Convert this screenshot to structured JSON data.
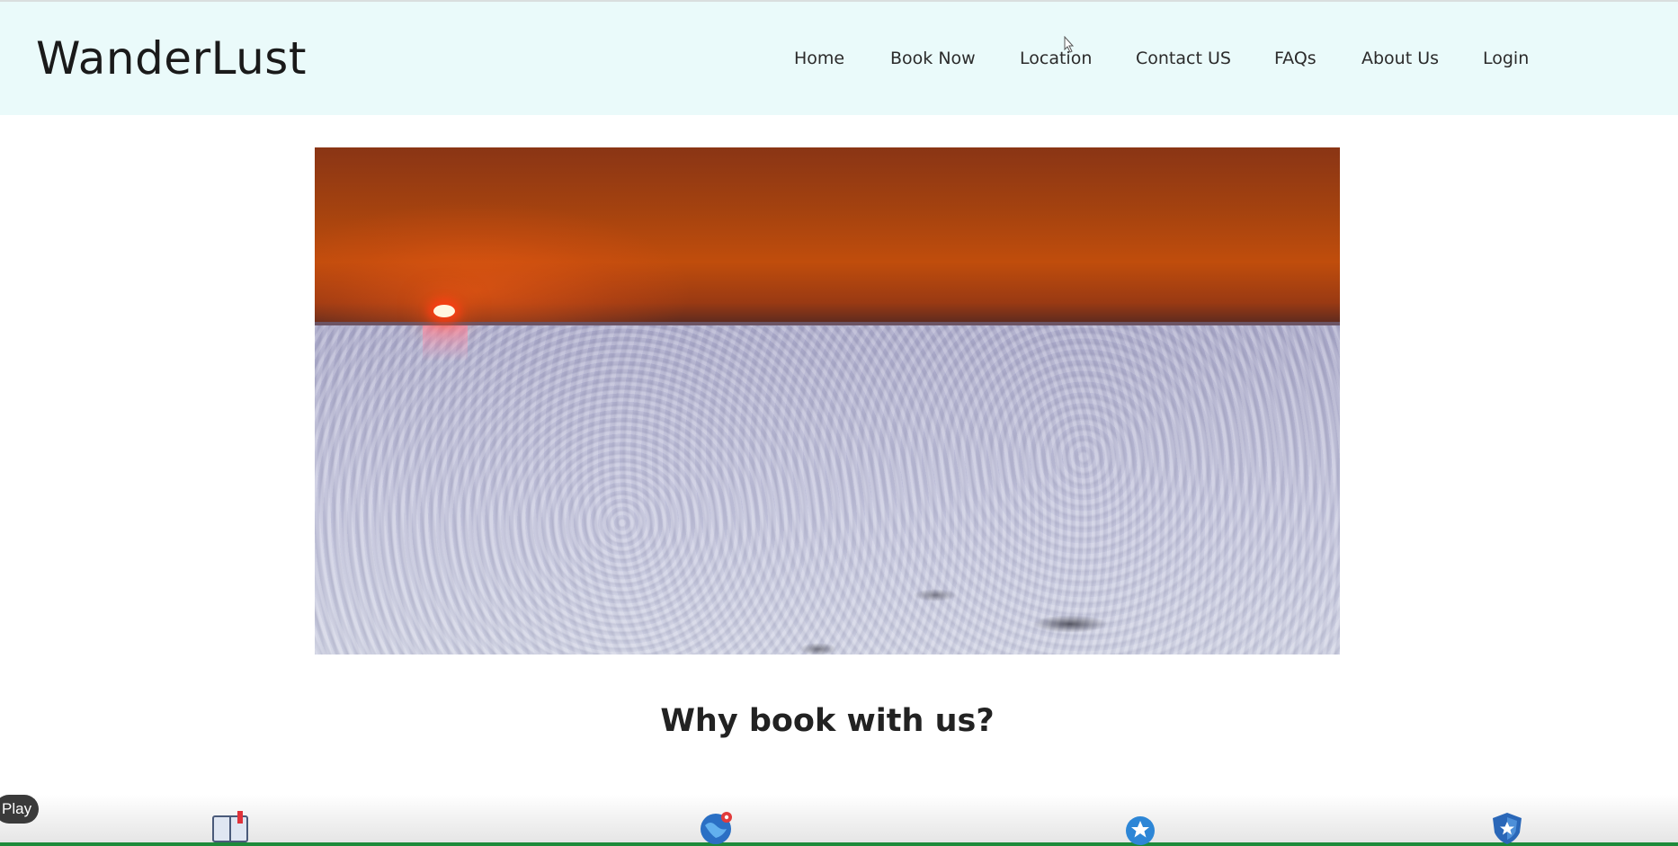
{
  "header": {
    "brand": "WanderLust",
    "nav": [
      {
        "label": "Home"
      },
      {
        "label": "Book Now"
      },
      {
        "label": "Location"
      },
      {
        "label": "Contact US"
      },
      {
        "label": "FAQs"
      },
      {
        "label": "About Us"
      },
      {
        "label": "Login"
      }
    ]
  },
  "hero": {
    "image": "sunset-over-salt-desert"
  },
  "section": {
    "heading": "Why book with us?"
  },
  "video_overlay": {
    "play_label": "Play"
  },
  "features": [
    {
      "icon": "book-icon"
    },
    {
      "icon": "globe-location-icon"
    },
    {
      "icon": "star-badge-icon"
    },
    {
      "icon": "shield-icon"
    }
  ],
  "colors": {
    "header_bg": "#eafafa",
    "heading_text": "#222222",
    "accent_bar": "#1e8a3a"
  }
}
